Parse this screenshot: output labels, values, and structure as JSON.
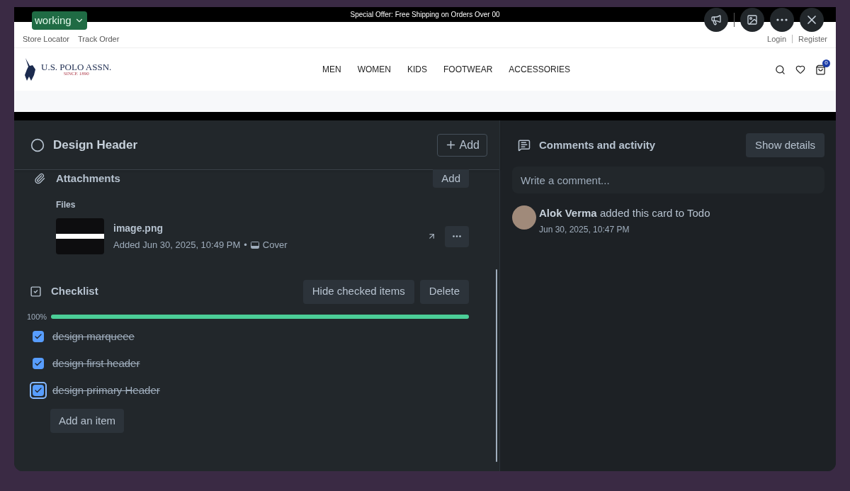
{
  "status_badge": {
    "label": "working"
  },
  "cover": {
    "promo": "Special Offer: Free Shipping on Orders Over 00",
    "top_links": [
      "Store Locator",
      "Track Order"
    ],
    "account_links": [
      "Login",
      "Register"
    ],
    "logo": {
      "name": "U.S. POLO ASSN.",
      "tagline": "SINCE 1890"
    },
    "nav": [
      "MEN",
      "WOMEN",
      "KIDS",
      "FOOTWEAR",
      "ACCESSORIES"
    ],
    "cart_count": "0"
  },
  "card": {
    "title": "Design Header",
    "completed": false,
    "add_button": "Add"
  },
  "attachments": {
    "title": "Attachments",
    "add_button": "Add",
    "files_label": "Files",
    "files": [
      {
        "name": "image.png",
        "added": "Added Jun 30, 2025, 10:49 PM",
        "separator": "•",
        "cover_label": "Cover"
      }
    ]
  },
  "checklist": {
    "title": "Checklist",
    "hide_button": "Hide checked items",
    "delete_button": "Delete",
    "percent": "100%",
    "level": 1,
    "add_item": "Add an item",
    "items": [
      {
        "text": "design marqueee",
        "checked": true,
        "focused": false
      },
      {
        "text": "design first header",
        "checked": true,
        "focused": false
      },
      {
        "text": "design primary Header",
        "checked": true,
        "focused": true
      }
    ]
  },
  "activity": {
    "title": "Comments and activity",
    "details_button": "Show details",
    "placeholder": "Write a comment...",
    "entries": [
      {
        "text": "**Alok Verma** added this card to Todo",
        "time": "Jun 30, 2025, 10:47 PM"
      }
    ]
  }
}
